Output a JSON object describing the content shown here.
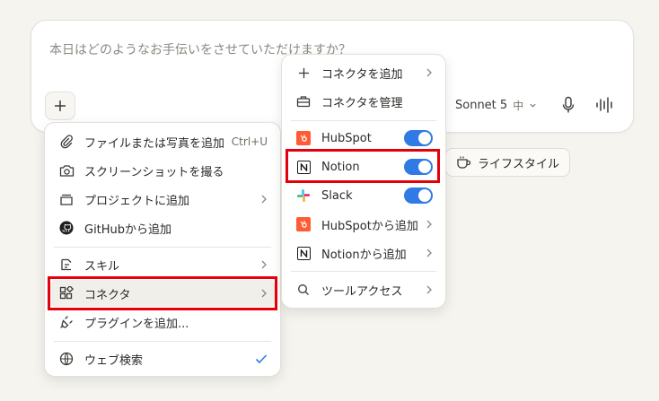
{
  "composer": {
    "placeholder": "本日はどのようなお手伝いをさせていただけますか？",
    "model_name": "Sonnet 5",
    "effort": "中"
  },
  "chip": {
    "label": "ライフスタイル"
  },
  "left_menu": {
    "items": [
      {
        "label": "ファイルまたは写真を追加",
        "shortcut": "Ctrl+U"
      },
      {
        "label": "スクリーンショットを撮る"
      },
      {
        "label": "プロジェクトに追加"
      },
      {
        "label": "GitHubから追加"
      },
      {
        "label": "スキル"
      },
      {
        "label": "コネクタ"
      },
      {
        "label": "プラグインを追加..."
      },
      {
        "label": "ウェブ検索"
      }
    ]
  },
  "right_menu": {
    "items": [
      {
        "label": "コネクタを追加"
      },
      {
        "label": "コネクタを管理"
      },
      {
        "label": "HubSpot",
        "enabled": true
      },
      {
        "label": "Notion",
        "enabled": true
      },
      {
        "label": "Slack",
        "enabled": true
      },
      {
        "label": "HubSpotから追加"
      },
      {
        "label": "Notionから追加"
      },
      {
        "label": "ツールアクセス"
      }
    ]
  },
  "colors": {
    "highlight_box": "#e3000b",
    "toggle_on": "#2f7ae5",
    "check": "#2f7ae5",
    "hubspot": "#ff5c35"
  }
}
